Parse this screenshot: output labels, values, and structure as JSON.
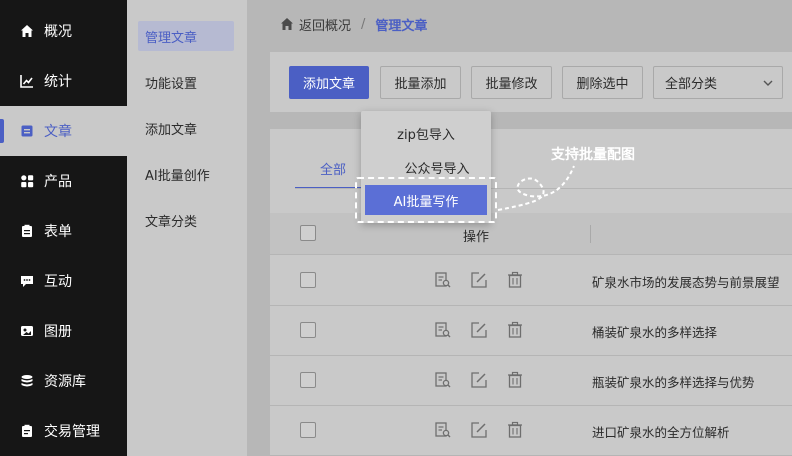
{
  "sidebar": {
    "items": [
      {
        "label": "概况",
        "icon": "home-icon"
      },
      {
        "label": "统计",
        "icon": "chart-icon"
      },
      {
        "label": "文章",
        "icon": "article-icon",
        "active": true
      },
      {
        "label": "产品",
        "icon": "grid-icon"
      },
      {
        "label": "表单",
        "icon": "form-icon"
      },
      {
        "label": "互动",
        "icon": "chat-icon"
      },
      {
        "label": "图册",
        "icon": "album-icon"
      },
      {
        "label": "资源库",
        "icon": "database-icon"
      },
      {
        "label": "交易管理",
        "icon": "order-icon"
      }
    ]
  },
  "submenu": {
    "items": [
      {
        "label": "管理文章",
        "active": true
      },
      {
        "label": "功能设置"
      },
      {
        "label": "添加文章"
      },
      {
        "label": "AI批量创作"
      },
      {
        "label": "文章分类"
      }
    ]
  },
  "breadcrumb": {
    "back": "返回概况",
    "separator": "/",
    "current": "管理文章"
  },
  "toolbar": {
    "add": "添加文章",
    "batch_add": "批量添加",
    "batch_edit": "批量修改",
    "delete_selected": "删除选中",
    "category_select": "全部分类"
  },
  "dropdown": {
    "items": [
      "zip包导入",
      "公众号导入",
      "AI批量写作"
    ]
  },
  "callout": {
    "text": "支持批量配图"
  },
  "tabs": {
    "all": "全部"
  },
  "table": {
    "op_header": "操作",
    "rows": [
      "矿泉水市场的发展态势与前景展望",
      "桶装矿泉水的多样选择",
      "瓶装矿泉水的多样选择与优势",
      "进口矿泉水的全方位解析"
    ]
  },
  "colors": {
    "accent": "#4b5fc4",
    "sidebar_bg": "#161616",
    "highlight": "#5b6fd6"
  }
}
